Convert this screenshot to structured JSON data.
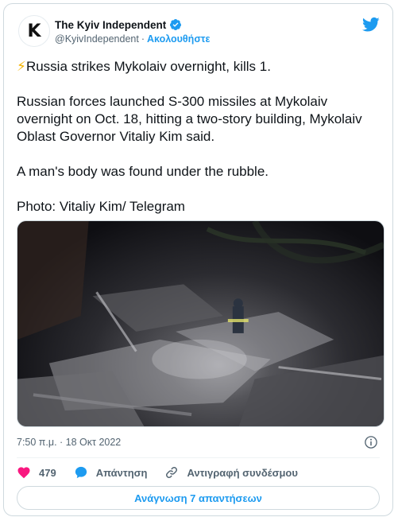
{
  "author": {
    "display_name": "The Kyiv Independent",
    "avatar_letter": "K",
    "handle": "@KyivIndependent",
    "separator": "·",
    "follow_label": "Ακολουθήστε"
  },
  "tweet": {
    "bolt": "⚡",
    "headline": "Russia strikes Mykolaiv overnight, kills 1.",
    "paragraph_1": "Russian forces launched S-300 missiles at Mykolaiv overnight on Oct. 18, hitting a two-story building, Mykolaiv Oblast Governor Vitaliy Kim said.",
    "paragraph_2": "A man's body was found under the rubble.",
    "paragraph_3": "Photo: Vitaliy Kim/ Telegram"
  },
  "meta": {
    "timestamp": "7:50 π.μ. · 18 Οκτ 2022"
  },
  "actions": {
    "like_count": "479",
    "reply_label": "Απάντηση",
    "copy_link_label": "Αντιγραφή συνδέσμου"
  },
  "replies_button_label": "Ανάγνωση 7 απαντήσεων",
  "colors": {
    "accent": "#1d9bf0",
    "like": "#f91880",
    "text": "#0f1419",
    "secondary": "#536471"
  },
  "icons": [
    "verified-badge-icon",
    "twitter-bird-icon",
    "info-icon",
    "heart-icon",
    "reply-bubble-icon",
    "link-icon"
  ]
}
